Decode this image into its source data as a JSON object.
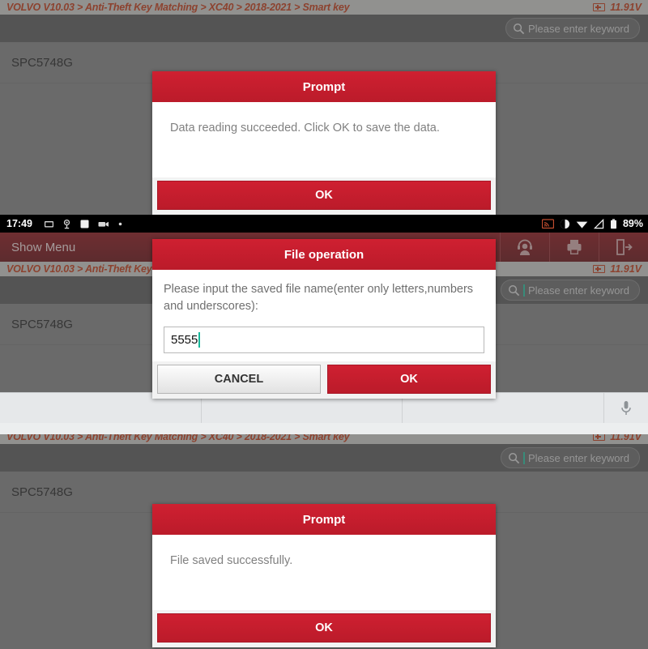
{
  "app": {
    "breadcrumb": "VOLVO V10.03 > Anti-Theft Key Matching > XC40 > 2018-2021 > Smart key",
    "voltage": "11.91V",
    "search_placeholder": "Please enter keyword",
    "list_item": "SPC5748G",
    "action_bar_title": "Show Menu"
  },
  "status_bar": {
    "time": "17:49",
    "battery_percent": "89%"
  },
  "panel1": {
    "dialog": {
      "title": "Prompt",
      "message": "Data reading succeeded. Click OK to save the data.",
      "ok_label": "OK"
    }
  },
  "panel2": {
    "dialog": {
      "title": "File operation",
      "message": "Please input the saved file name(enter only letters,numbers and underscores):",
      "input_value": "5555",
      "cancel_label": "CANCEL",
      "ok_label": "OK"
    }
  },
  "panel3": {
    "dialog": {
      "title": "Prompt",
      "message": "File saved successfully.",
      "ok_label": "OK"
    }
  },
  "colors": {
    "brand_red": "#c9202f",
    "breadcrumb_text": "#c0401f",
    "action_bar": "#7d1c21",
    "app_background": "#868686"
  }
}
